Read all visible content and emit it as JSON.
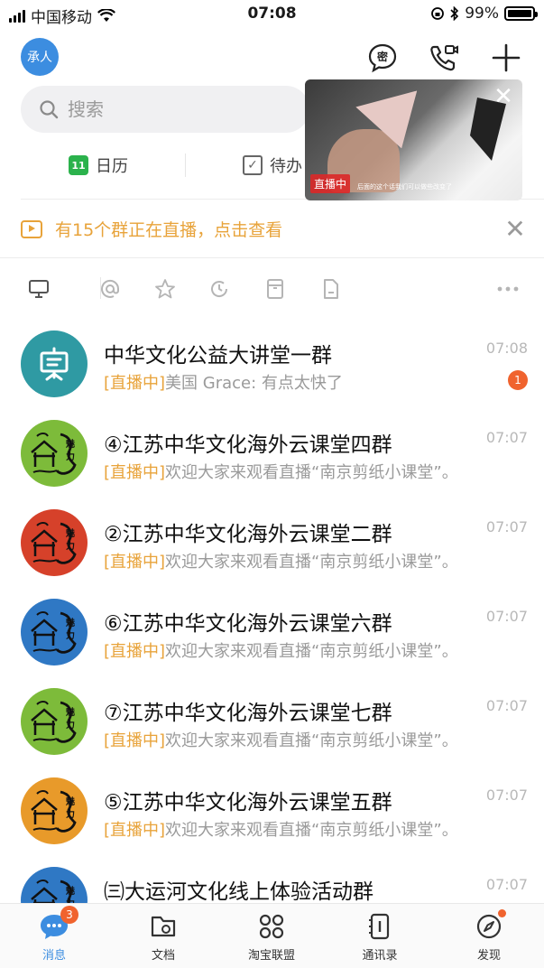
{
  "status_bar": {
    "carrier": "中国移动",
    "time": "07:08",
    "battery": "99%",
    "battery_fraction": 0.99
  },
  "header": {
    "avatar_text": "承人",
    "icons": [
      "secret-chat-icon",
      "video-call-icon",
      "plus-icon"
    ]
  },
  "search": {
    "placeholder": "搜索"
  },
  "quick_tabs": [
    {
      "label": "日历",
      "icon_text": "11"
    },
    {
      "label": "待办"
    }
  ],
  "live_video": {
    "tag": "直播中",
    "caption": "后面的这个话我们可以做些改变了"
  },
  "banner": {
    "text": "有15个群正在直播，点击查看"
  },
  "filter_icons": [
    "monitor-icon",
    "at-icon",
    "star-icon",
    "clock-icon",
    "archive-icon",
    "document-icon",
    "more-icon"
  ],
  "conversations": [
    {
      "title": "中华文化公益大讲堂一群",
      "live_label": "[直播中]",
      "preview": "美国 Grace: 有点太快了",
      "time": "07:08",
      "unread": "1",
      "avatar_color": "#2f9aa3",
      "avatar_type": "lecture"
    },
    {
      "title": "④江苏中华文化海外云课堂四群",
      "live_label": "[直播中]",
      "preview": "欢迎大家来观看直播“南京剪纸小课堂”。",
      "time": "07:07",
      "avatar_color": "#7dbb3a",
      "avatar_type": "logo"
    },
    {
      "title": "②江苏中华文化海外云课堂二群",
      "live_label": "[直播中]",
      "preview": "欢迎大家来观看直播“南京剪纸小课堂”。",
      "time": "07:07",
      "avatar_color": "#d6412a",
      "avatar_type": "logo"
    },
    {
      "title": "⑥江苏中华文化海外云课堂六群",
      "live_label": "[直播中]",
      "preview": "欢迎大家来观看直播“南京剪纸小课堂”。",
      "time": "07:07",
      "avatar_color": "#2f78c4",
      "avatar_type": "logo"
    },
    {
      "title": "⑦江苏中华文化海外云课堂七群",
      "live_label": "[直播中]",
      "preview": "欢迎大家来观看直播“南京剪纸小课堂”。",
      "time": "07:07",
      "avatar_color": "#7dbb3a",
      "avatar_type": "logo"
    },
    {
      "title": "⑤江苏中华文化海外云课堂五群",
      "live_label": "[直播中]",
      "preview": "欢迎大家来观看直播“南京剪纸小课堂”。",
      "time": "07:07",
      "avatar_color": "#e89a2a",
      "avatar_type": "logo"
    },
    {
      "title": "㈢大运河文化线上体验活动群",
      "live_label": "",
      "preview": "",
      "time": "07:07",
      "avatar_color": "#2f78c4",
      "avatar_type": "logo"
    }
  ],
  "tabbar": [
    {
      "label": "消息",
      "badge": "3",
      "active": true
    },
    {
      "label": "文档"
    },
    {
      "label": "淘宝联盟"
    },
    {
      "label": "通讯录"
    },
    {
      "label": "发现",
      "dot": true
    }
  ],
  "colors": {
    "accent": "#3c8de0",
    "live": "#e8a33a",
    "badge": "#f0632e"
  }
}
